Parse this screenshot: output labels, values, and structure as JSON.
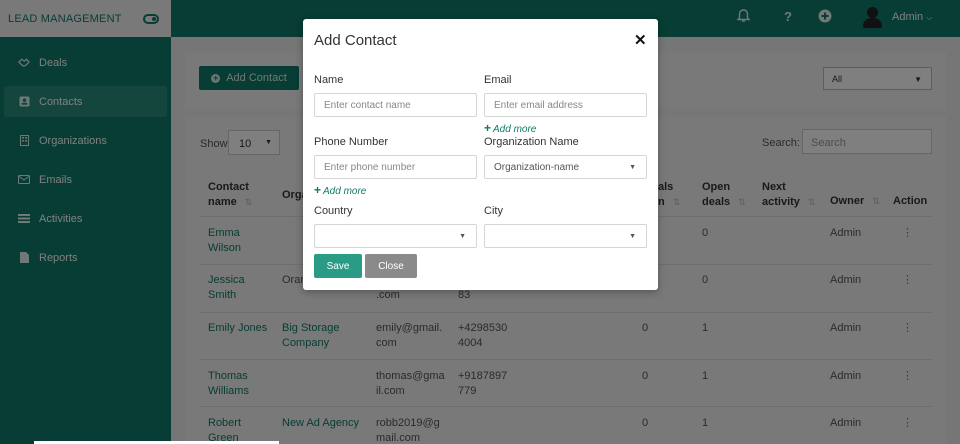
{
  "app": {
    "brand": "LEAD MANAGEMENT",
    "accent": "#0e7a68"
  },
  "sidebar": {
    "items": [
      {
        "label": "Deals",
        "icon": "handshake-icon"
      },
      {
        "label": "Contacts",
        "icon": "contact-card-icon",
        "active": true
      },
      {
        "label": "Organizations",
        "icon": "building-icon"
      },
      {
        "label": "Emails",
        "icon": "envelope-icon"
      },
      {
        "label": "Activities",
        "icon": "list-icon"
      },
      {
        "label": "Reports",
        "icon": "document-icon"
      }
    ]
  },
  "topbar": {
    "icons": [
      "bell-icon",
      "help-icon",
      "add-circle-icon"
    ],
    "help_glyph": "?",
    "user": "Admin"
  },
  "toolbar": {
    "add_contact_label": "Add Contact",
    "filter_value": "All",
    "show_label": "Show",
    "show_value": "10",
    "search_label": "Search:",
    "search_placeholder": "Search"
  },
  "table": {
    "headers": {
      "contact_name": "Contact name",
      "organization": "Orga",
      "deals": "als",
      "deals_line2": "n",
      "open_deals": "Open deals",
      "next_activity": "Next activity",
      "owner": "Owner",
      "action": "Action"
    },
    "rows": [
      {
        "name": "Emma Wilson",
        "org": "",
        "email": "",
        "phone": "",
        "deals": "",
        "open": "0",
        "owner": "Admin"
      },
      {
        "name": "Jessica Smith",
        "org": "Orar",
        "email": ".com",
        "phone": "83",
        "deals": "",
        "open": "0",
        "owner": "Admin"
      },
      {
        "name": "Emily Jones",
        "org": "Big Storage Company",
        "email": "emily@gmail. com",
        "phone": "+4298530 4004",
        "deals": "0",
        "open": "1",
        "owner": "Admin"
      },
      {
        "name": "Thomas Williams",
        "org": "",
        "email": "thomas@gma il.com",
        "phone": "+9187897 779",
        "deals": "0",
        "open": "1",
        "owner": "Admin"
      },
      {
        "name": "Robert Green",
        "org": "New Ad Agency",
        "email": "robb2019@g mail.com",
        "phone": "",
        "deals": "0",
        "open": "1",
        "owner": "Admin"
      }
    ],
    "action_glyph": "⋮"
  },
  "modal": {
    "title": "Add Contact",
    "close_glyph": "✕",
    "name_label": "Name",
    "name_placeholder": "Enter  contact name",
    "email_label": "Email",
    "email_placeholder": "Enter email address",
    "add_more_label": "Add more",
    "phone_label": "Phone Number",
    "phone_placeholder": "Enter phone number",
    "org_label": "Organization Name",
    "org_value": "Organization-name",
    "country_label": "Country",
    "country_value": "",
    "city_label": "City",
    "city_value": "",
    "save_label": "Save",
    "close_label": "Close"
  }
}
